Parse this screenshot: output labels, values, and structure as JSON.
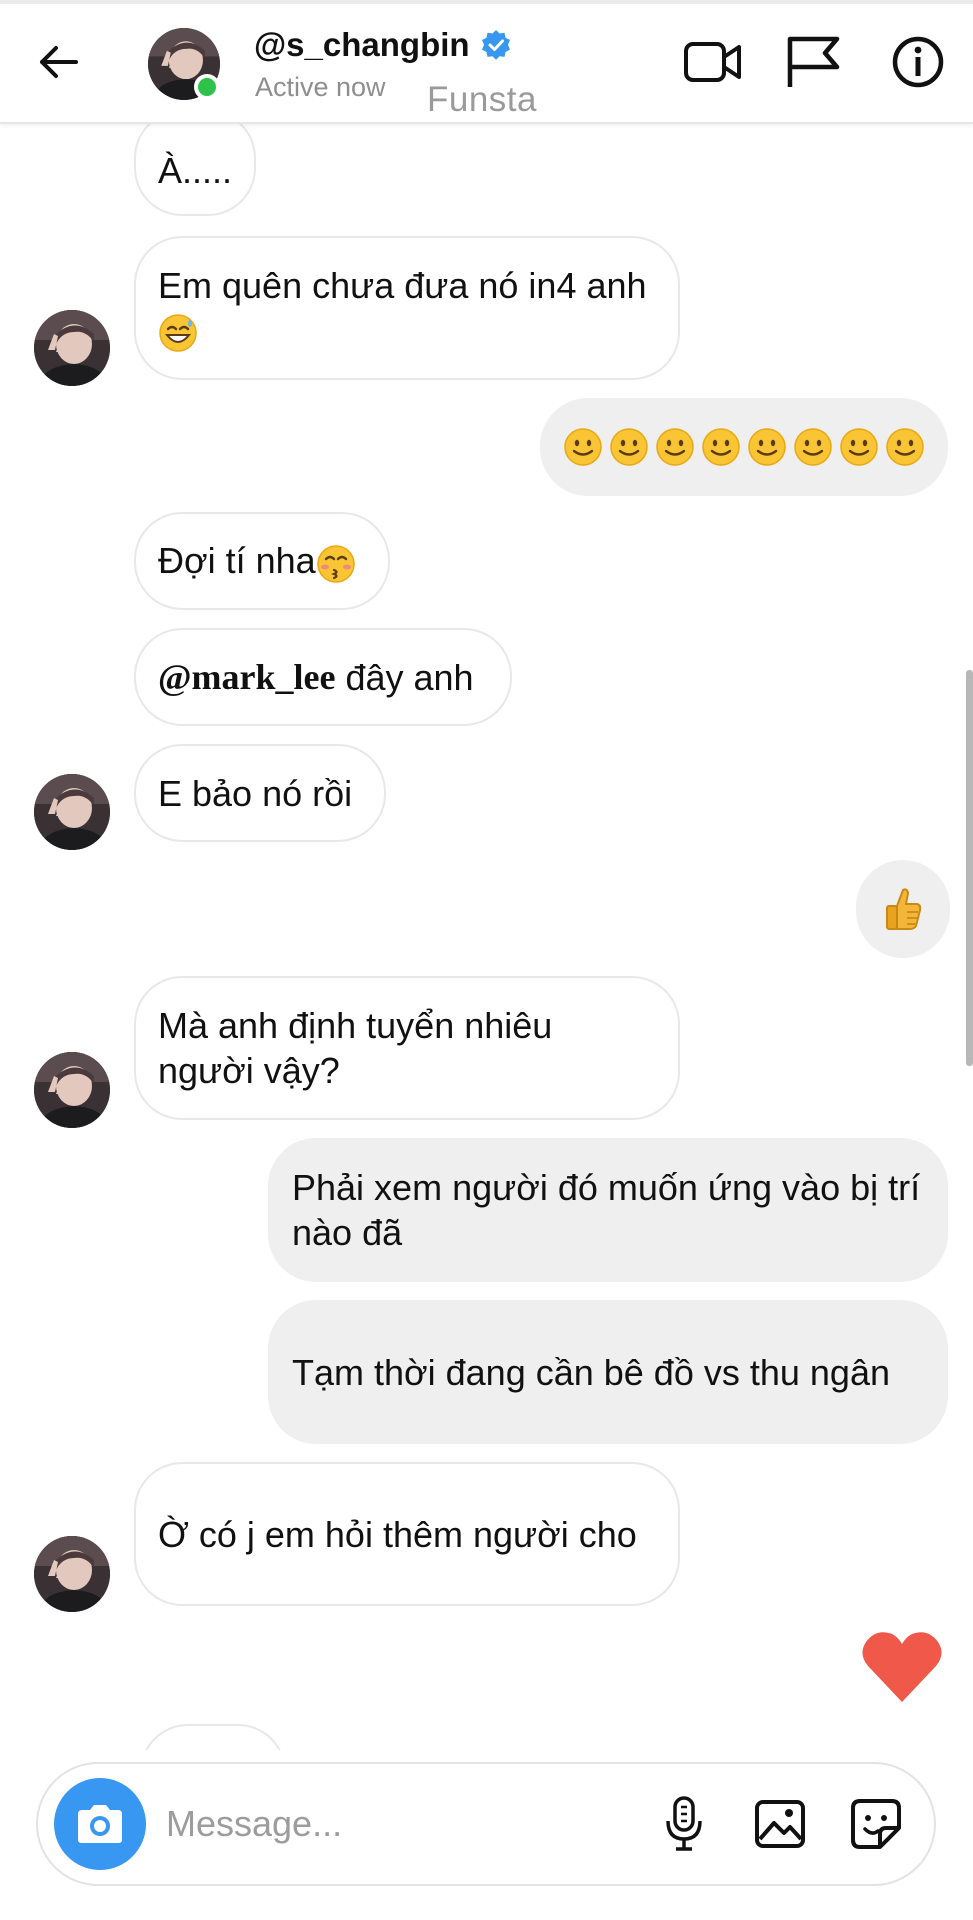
{
  "header": {
    "username": "@s_changbin",
    "status": "Active now",
    "watermark": "Funsta",
    "icons": [
      "back-arrow-icon",
      "verified-badge-icon",
      "video-call-icon",
      "flag-icon",
      "info-icon"
    ]
  },
  "messages": [
    {
      "side": "in",
      "text": "À....."
    },
    {
      "side": "in",
      "text": "Em quên chưa đưa nó in4 anh",
      "emoji": "sweat-smile-emoji"
    },
    {
      "side": "out",
      "emoji": "slightly-smiling-face-emoji",
      "emoji_count": 8
    },
    {
      "side": "in",
      "text": "Đợi tí nha",
      "emoji": "kissing-emoji"
    },
    {
      "side": "in",
      "mention": "@mark_lee",
      "text": "đây anh"
    },
    {
      "side": "in",
      "text": "E bảo nó rồi"
    },
    {
      "side": "out",
      "emoji": "thumbs-up-emoji"
    },
    {
      "side": "in",
      "text": "Mà anh định tuyển nhiêu người vậy?"
    },
    {
      "side": "out",
      "text": "Phải xem người đó muốn ứng vào bị trí nào đã"
    },
    {
      "side": "out",
      "text": "Tạm thời đang cần bê đồ vs thu ngân"
    },
    {
      "side": "in",
      "text": "Ờ có j em hỏi thêm người cho"
    },
    {
      "side": "out",
      "emoji": "heart-emoji"
    }
  ],
  "composer": {
    "placeholder": "Message...",
    "value": "",
    "icons": [
      "camera-icon",
      "microphone-icon",
      "gallery-icon",
      "sticker-icon"
    ]
  },
  "colors": {
    "accent": "#3897f0",
    "online": "#2ec24a",
    "heart": "#f0584a",
    "outgoing_bubble": "#efefef",
    "incoming_border": "#e8e8e8"
  }
}
